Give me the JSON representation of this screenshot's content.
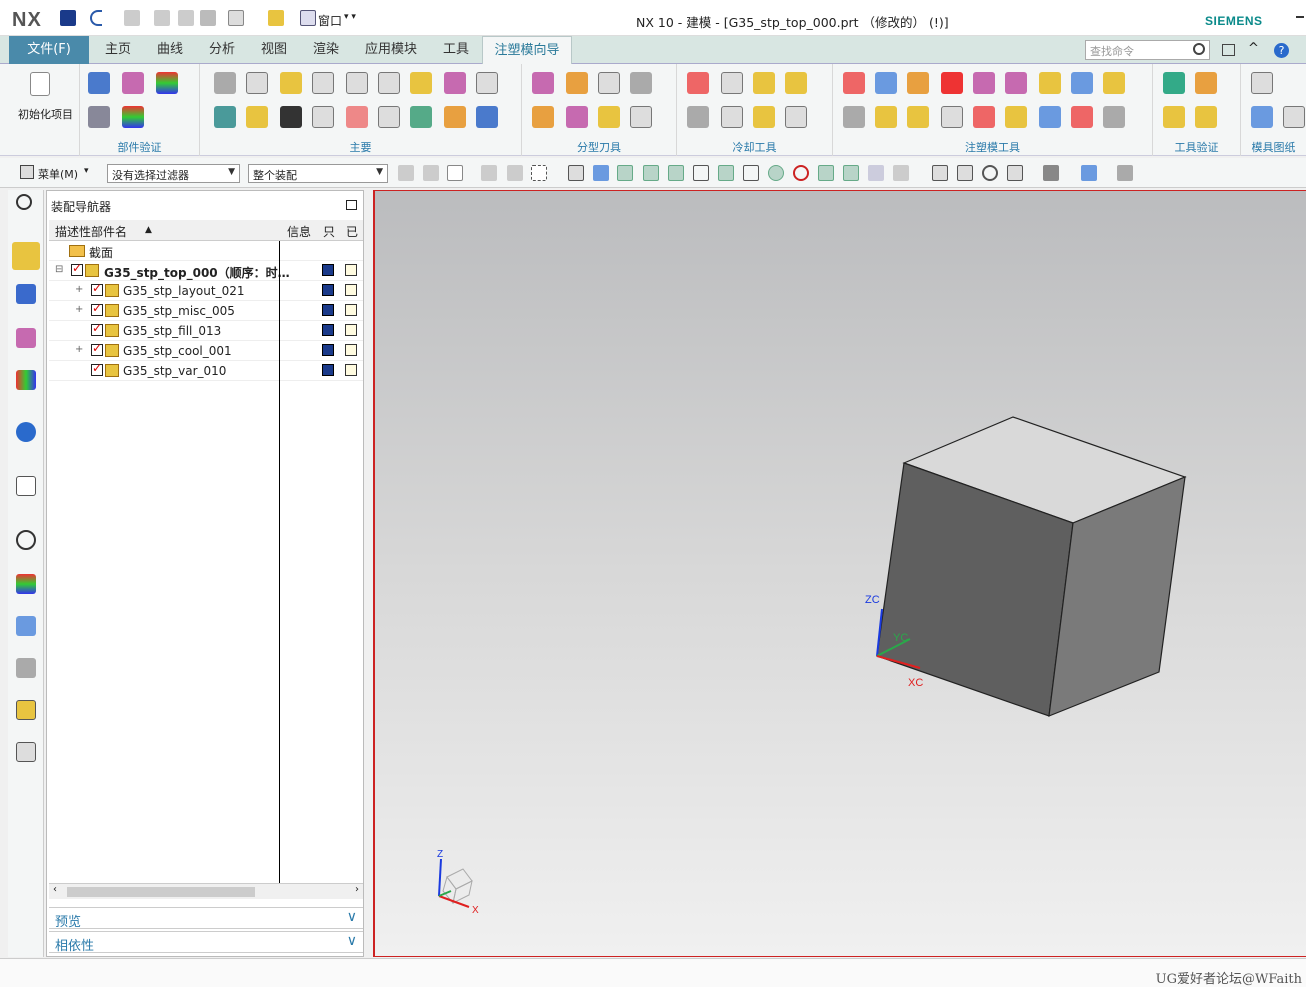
{
  "titlebar": {
    "logo": "NX",
    "title": "NX 10 - 建模 - [G35_stp_top_000.prt  （修改的）    (!)]",
    "brand": "SIEMENS",
    "window_label": "窗口"
  },
  "tabs": [
    {
      "label": "文件(F)"
    },
    {
      "label": "主页"
    },
    {
      "label": "曲线"
    },
    {
      "label": "分析"
    },
    {
      "label": "视图"
    },
    {
      "label": "渲染"
    },
    {
      "label": "应用模块"
    },
    {
      "label": "工具"
    },
    {
      "label": "注塑模向导"
    }
  ],
  "search": {
    "placeholder": "查找命令"
  },
  "ribbon": {
    "init_label": "初始化项目",
    "groups": [
      "部件验证",
      "主要",
      "分型刀具",
      "冷却工具",
      "注塑模工具",
      "工具验证",
      "模具图纸"
    ]
  },
  "toolbar2": {
    "menu": "菜单(M)",
    "filter": "没有选择过滤器",
    "scope": "整个装配"
  },
  "navigator": {
    "title": "装配导航器",
    "columns": [
      "描述性部件名",
      "信息",
      "只",
      "已"
    ],
    "section_row": "截面",
    "top": "G35_stp_top_000（顺序：时…",
    "children": [
      "G35_stp_layout_021",
      "G35_stp_misc_005",
      "G35_stp_fill_013",
      "G35_stp_cool_001",
      "G35_stp_var_010"
    ],
    "sections": [
      "预览",
      "相依性"
    ]
  },
  "viewport": {
    "axes": {
      "zc": "ZC",
      "yc": "YC",
      "xc": "XC",
      "z": "Z",
      "x": "X"
    }
  },
  "status": {
    "watermark": "UG爱好者论坛@WFaith"
  },
  "colors": {
    "accent": "#2a7aaa",
    "file_tab": "#4a8aaa",
    "brand": "#0a8a8a",
    "viewport_border": "#cc2222"
  }
}
